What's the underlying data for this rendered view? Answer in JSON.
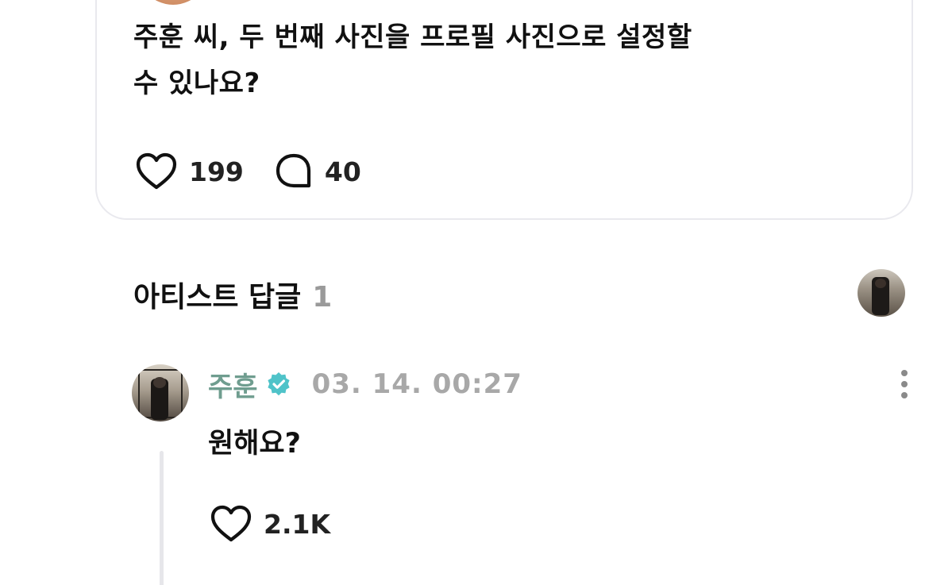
{
  "post": {
    "text_line1": "주훈 씨, 두 번째 사진을 프로필 사진으로 설정할",
    "text_line2": "수 있나요?",
    "like_count": "199",
    "comment_count": "40"
  },
  "section": {
    "title": "아티스트 답글",
    "count": "1"
  },
  "reply": {
    "author": "주훈",
    "timestamp": "03. 14. 00:27",
    "text": "원해요?",
    "like_count": "2.1K",
    "verified_color": "#4fc3c9",
    "author_color": "#6f9d8f"
  },
  "icons": {
    "like": "heart-icon",
    "comment": "speech-bubble-icon",
    "verified": "verified-badge-icon",
    "more": "more-vertical-icon"
  }
}
